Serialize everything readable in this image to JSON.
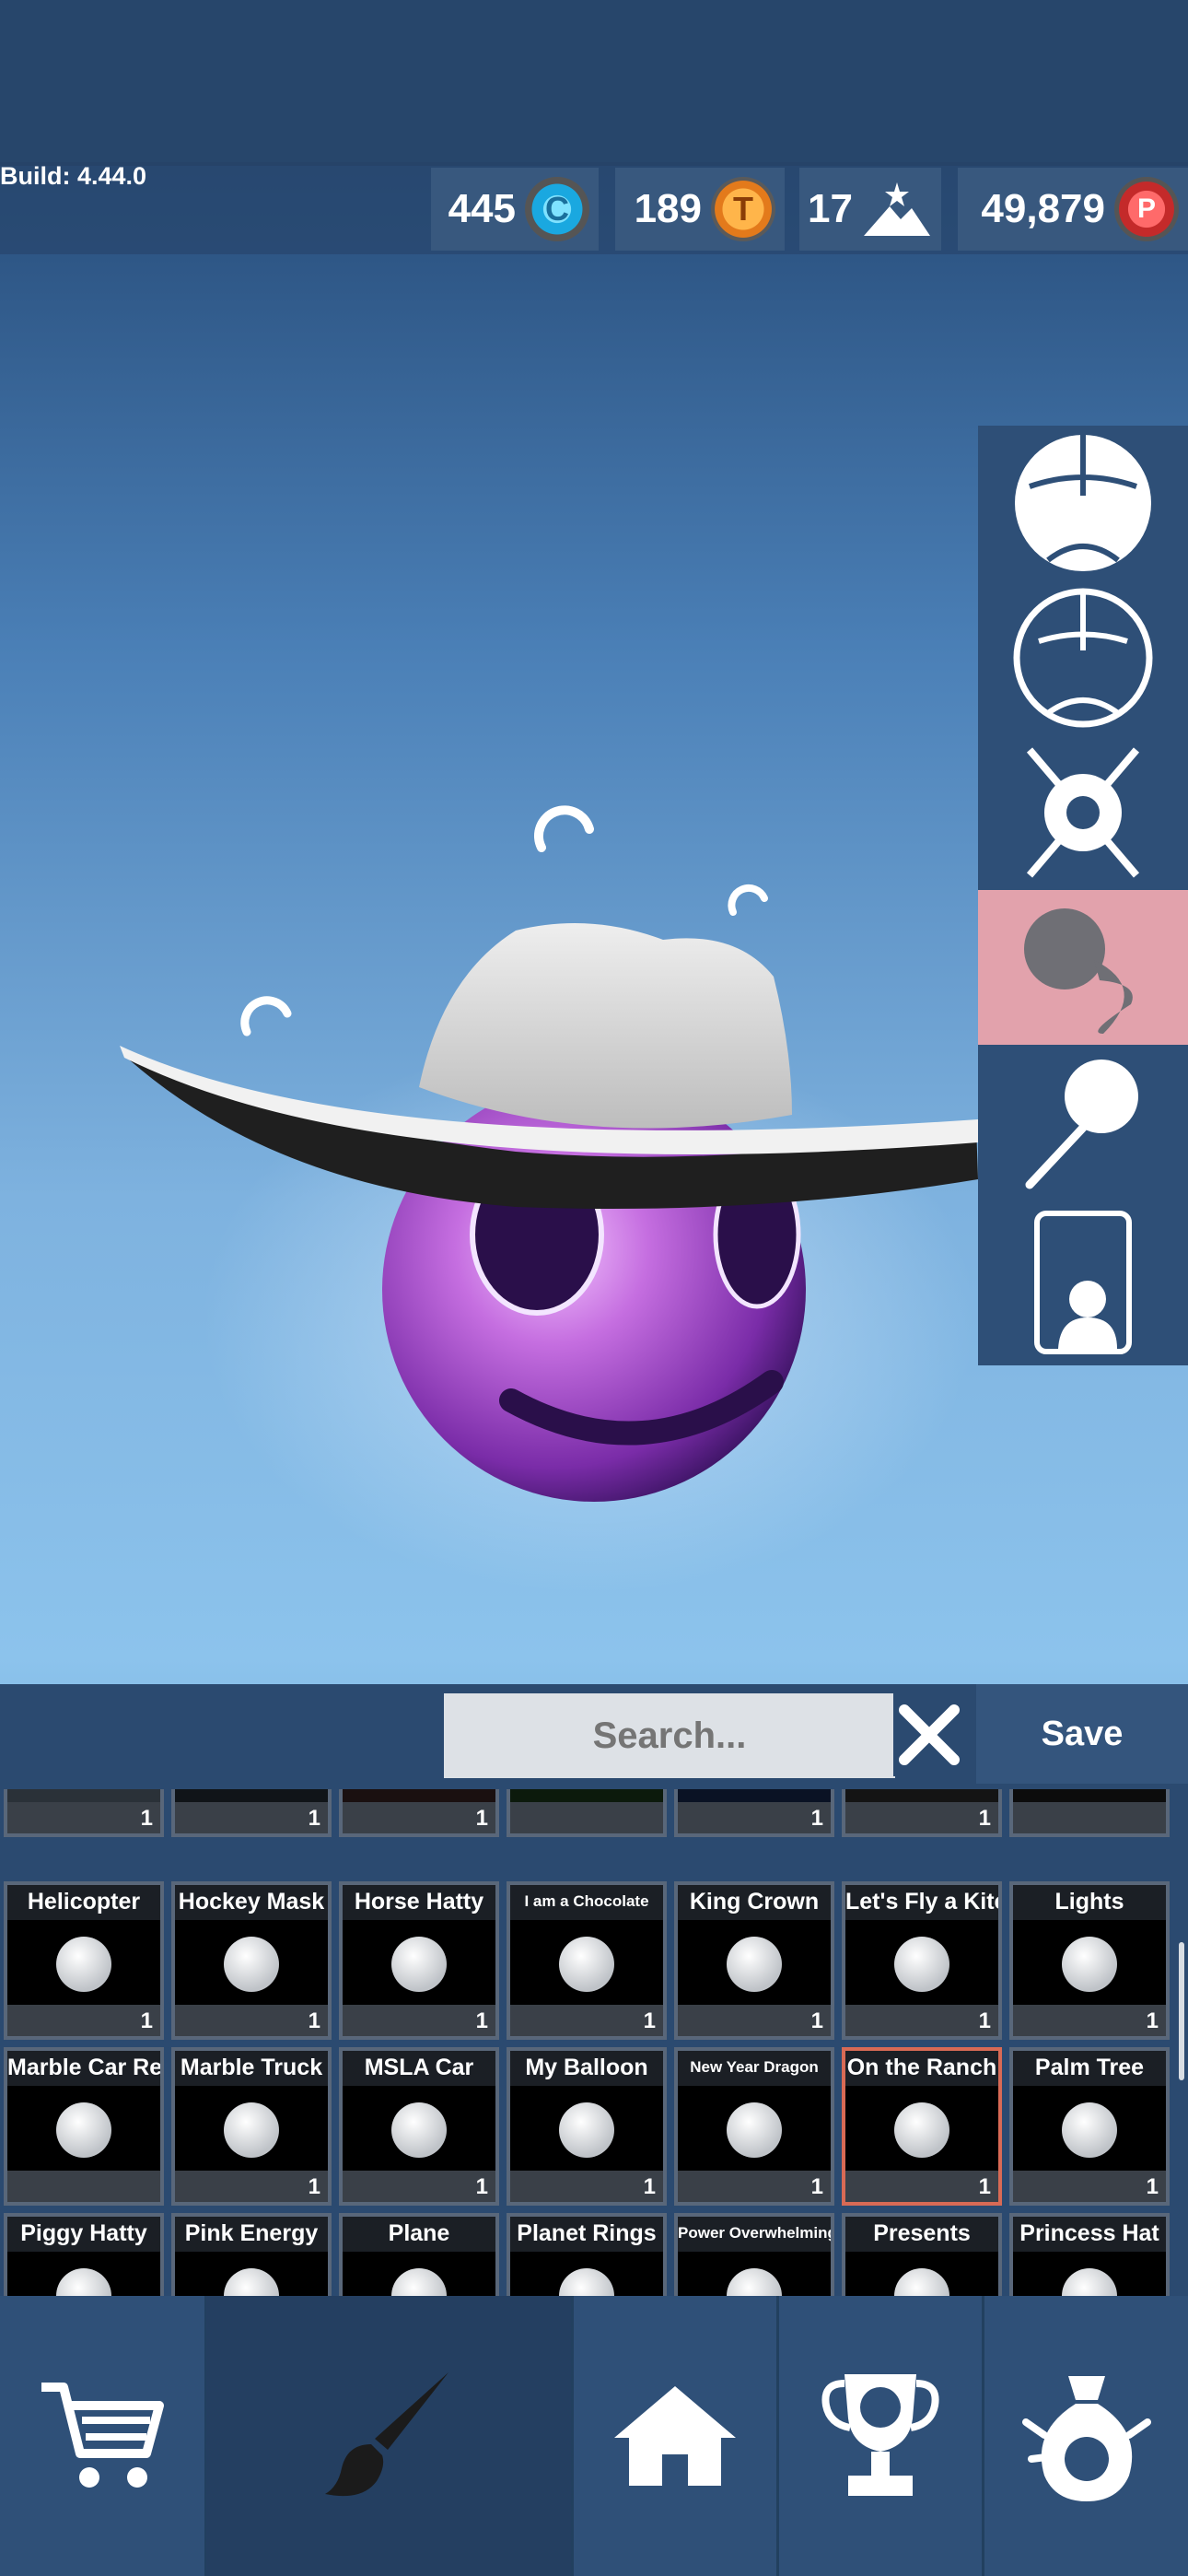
{
  "build": "Build: 4.44.0",
  "currencies": [
    {
      "value": "445",
      "icon": "cyan-coin-icon",
      "color": "#28b6e8"
    },
    {
      "value": "189",
      "icon": "orange-coin-icon",
      "color": "#f08a2a"
    },
    {
      "value": "17",
      "icon": "mountain-star-icon",
      "color": "#ffffff"
    },
    {
      "value": "49,879",
      "icon": "red-coin-icon",
      "color": "#d43a3a"
    }
  ],
  "side_tools": [
    {
      "icon": "marble-filled-icon"
    },
    {
      "icon": "marble-outline-icon"
    },
    {
      "icon": "explosion-icon"
    },
    {
      "icon": "trail-icon",
      "selected": true
    },
    {
      "icon": "pin-icon"
    },
    {
      "icon": "profile-card-icon"
    }
  ],
  "search": {
    "placeholder": "Search..."
  },
  "save_label": "Save",
  "items_row_partial": [
    {
      "count": "1"
    },
    {
      "count": "1"
    },
    {
      "count": "1"
    },
    {
      "count": ""
    },
    {
      "count": "1"
    },
    {
      "count": "1"
    },
    {
      "count": ""
    }
  ],
  "items": [
    {
      "label": "Helicopter",
      "count": "1"
    },
    {
      "label": "Hockey Mask",
      "count": "1"
    },
    {
      "label": "Horse Hatty",
      "count": "1"
    },
    {
      "label": "I am a Chocolate",
      "count": "1",
      "small": true
    },
    {
      "label": "King Crown",
      "count": "1"
    },
    {
      "label": "Let's Fly a Kite",
      "count": "1"
    },
    {
      "label": "Lights",
      "count": "1"
    },
    {
      "label": "Marble Car Red",
      "count": ""
    },
    {
      "label": "Marble Truck",
      "count": "1"
    },
    {
      "label": "MSLA Car",
      "count": "1"
    },
    {
      "label": "My Balloon",
      "count": "1"
    },
    {
      "label": "New Year Dragon",
      "count": "1",
      "small": true
    },
    {
      "label": "On the Ranch",
      "count": "1",
      "selected": true
    },
    {
      "label": "Palm Tree",
      "count": "1"
    },
    {
      "label": "Piggy Hatty",
      "count": ""
    },
    {
      "label": "Pink Energy",
      "count": ""
    },
    {
      "label": "Plane",
      "count": ""
    },
    {
      "label": "Planet Rings",
      "count": ""
    },
    {
      "label": "Power Overwhelming",
      "count": "",
      "small": true
    },
    {
      "label": "Presents",
      "count": ""
    },
    {
      "label": "Princess Hat",
      "count": ""
    }
  ],
  "nav": [
    {
      "icon": "cart-icon"
    },
    {
      "icon": "paintbrush-icon",
      "active": true
    },
    {
      "icon": "home-icon"
    },
    {
      "icon": "trophy-icon"
    },
    {
      "icon": "prize-bag-icon"
    }
  ]
}
